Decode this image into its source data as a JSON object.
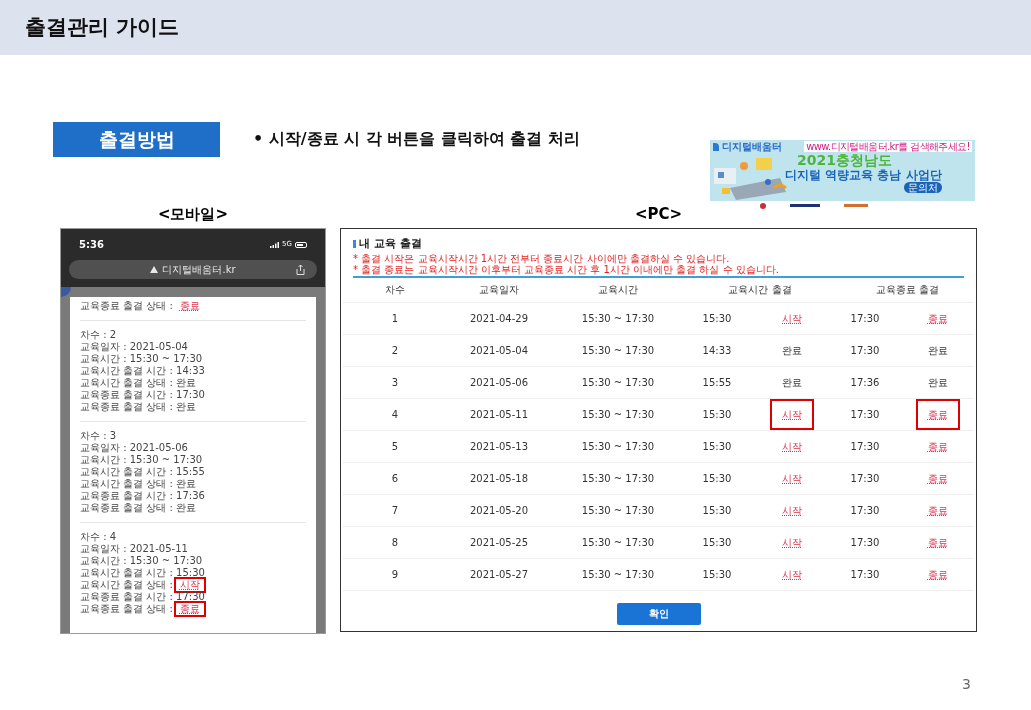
{
  "header": {
    "title": "출결관리 가이드"
  },
  "section": {
    "label": "출결방법",
    "instruction": "• 시작/종료 시 각 버튼을 클릭하여 출결 처리"
  },
  "banner": {
    "logo": "디지털배움터",
    "bubble": "www.디지털배움터.kr를 검색해주세요!",
    "headline": "2021충청남도",
    "subline": "디지털 역량교육 충남 사업단",
    "contact": "문의처"
  },
  "captions": {
    "mobile": "<모바일>",
    "pc": "<PC>"
  },
  "mobile": {
    "time": "5:36",
    "network": "5G",
    "url": "디지털배움터.kr",
    "blocks": [
      {
        "lines": [
          {
            "label": "교육종료 출결 상태 :",
            "value": "종료",
            "kind": "link",
            "highlighted": false
          }
        ]
      },
      {
        "lines": [
          {
            "label": "차수 :",
            "value": "2",
            "kind": "text"
          },
          {
            "label": "교육일자 :",
            "value": "2021-05-04",
            "kind": "text"
          },
          {
            "label": "교육시간 :",
            "value": "15:30 ~ 17:30",
            "kind": "text"
          },
          {
            "label": "교육시간 출결 시간 :",
            "value": "14:33",
            "kind": "text"
          },
          {
            "label": "교육시간 출결 상태 :",
            "value": "완료",
            "kind": "text"
          },
          {
            "label": "교육종료 출결 시간 :",
            "value": "17:30",
            "kind": "text"
          },
          {
            "label": "교육종료 출결 상태 :",
            "value": "완료",
            "kind": "text"
          }
        ]
      },
      {
        "lines": [
          {
            "label": "차수 :",
            "value": "3",
            "kind": "text"
          },
          {
            "label": "교육일자 :",
            "value": "2021-05-06",
            "kind": "text"
          },
          {
            "label": "교육시간 :",
            "value": "15:30 ~ 17:30",
            "kind": "text"
          },
          {
            "label": "교육시간 출결 시간 :",
            "value": "15:55",
            "kind": "text"
          },
          {
            "label": "교육시간 출결 상태 :",
            "value": "완료",
            "kind": "text"
          },
          {
            "label": "교육종료 출결 시간 :",
            "value": "17:36",
            "kind": "text"
          },
          {
            "label": "교육종료 출결 상태 :",
            "value": "완료",
            "kind": "text"
          }
        ]
      },
      {
        "lines": [
          {
            "label": "차수 :",
            "value": "4",
            "kind": "text"
          },
          {
            "label": "교육일자 :",
            "value": "2021-05-11",
            "kind": "text"
          },
          {
            "label": "교육시간 :",
            "value": "15:30 ~ 17:30",
            "kind": "text"
          },
          {
            "label": "교육시간 출결 시간 :",
            "value": "15:30",
            "kind": "text"
          },
          {
            "label": "교육시간 출결 상태 :",
            "value": "시작",
            "kind": "link",
            "highlighted": true
          },
          {
            "label": "교육종료 출결 시간 :",
            "value": "17:30",
            "kind": "text"
          },
          {
            "label": "교육종료 출결 상태 :",
            "value": "종료",
            "kind": "link",
            "highlighted": true
          }
        ]
      }
    ]
  },
  "pc": {
    "title": "내 교육 출결",
    "notes": [
      "* 출결 시작은 교육시작시간 1시간 전부터 종료시간 사이에만 출결하실 수 있습니다.",
      "* 출결 종료는 교육시작시간 이후부터 교육종료 시간 후 1시간 이내에만 출결 하실 수 있습니다."
    ],
    "columns": [
      "차수",
      "교육일자",
      "교육시간",
      "교육시간 출결",
      "교육종료 출결"
    ],
    "rows": [
      {
        "no": "1",
        "date": "2021-04-29",
        "time": "15:30 ~ 17:30",
        "start_time": "15:30",
        "start_status": {
          "text": "시작",
          "kind": "link",
          "highlighted": false
        },
        "end_time": "17:30",
        "end_status": {
          "text": "종료",
          "kind": "link",
          "highlighted": false
        }
      },
      {
        "no": "2",
        "date": "2021-05-04",
        "time": "15:30 ~ 17:30",
        "start_time": "14:33",
        "start_status": {
          "text": "완료",
          "kind": "done",
          "highlighted": false
        },
        "end_time": "17:30",
        "end_status": {
          "text": "완료",
          "kind": "done",
          "highlighted": false
        }
      },
      {
        "no": "3",
        "date": "2021-05-06",
        "time": "15:30 ~ 17:30",
        "start_time": "15:55",
        "start_status": {
          "text": "완료",
          "kind": "done",
          "highlighted": false
        },
        "end_time": "17:36",
        "end_status": {
          "text": "완료",
          "kind": "done",
          "highlighted": false
        }
      },
      {
        "no": "4",
        "date": "2021-05-11",
        "time": "15:30 ~ 17:30",
        "start_time": "15:30",
        "start_status": {
          "text": "시작",
          "kind": "link",
          "highlighted": true
        },
        "end_time": "17:30",
        "end_status": {
          "text": "종료",
          "kind": "link",
          "highlighted": true
        }
      },
      {
        "no": "5",
        "date": "2021-05-13",
        "time": "15:30 ~ 17:30",
        "start_time": "15:30",
        "start_status": {
          "text": "시작",
          "kind": "link",
          "highlighted": false
        },
        "end_time": "17:30",
        "end_status": {
          "text": "종료",
          "kind": "link",
          "highlighted": false
        }
      },
      {
        "no": "6",
        "date": "2021-05-18",
        "time": "15:30 ~ 17:30",
        "start_time": "15:30",
        "start_status": {
          "text": "시작",
          "kind": "link",
          "highlighted": false
        },
        "end_time": "17:30",
        "end_status": {
          "text": "종료",
          "kind": "link",
          "highlighted": false
        }
      },
      {
        "no": "7",
        "date": "2021-05-20",
        "time": "15:30 ~ 17:30",
        "start_time": "15:30",
        "start_status": {
          "text": "시작",
          "kind": "link",
          "highlighted": false
        },
        "end_time": "17:30",
        "end_status": {
          "text": "종료",
          "kind": "link",
          "highlighted": false
        }
      },
      {
        "no": "8",
        "date": "2021-05-25",
        "time": "15:30 ~ 17:30",
        "start_time": "15:30",
        "start_status": {
          "text": "시작",
          "kind": "link",
          "highlighted": false
        },
        "end_time": "17:30",
        "end_status": {
          "text": "종료",
          "kind": "link",
          "highlighted": false
        }
      },
      {
        "no": "9",
        "date": "2021-05-27",
        "time": "15:30 ~ 17:30",
        "start_time": "15:30",
        "start_status": {
          "text": "시작",
          "kind": "link",
          "highlighted": false
        },
        "end_time": "17:30",
        "end_status": {
          "text": "종료",
          "kind": "link",
          "highlighted": false
        }
      }
    ],
    "confirm": "확인"
  },
  "page_number": "3"
}
